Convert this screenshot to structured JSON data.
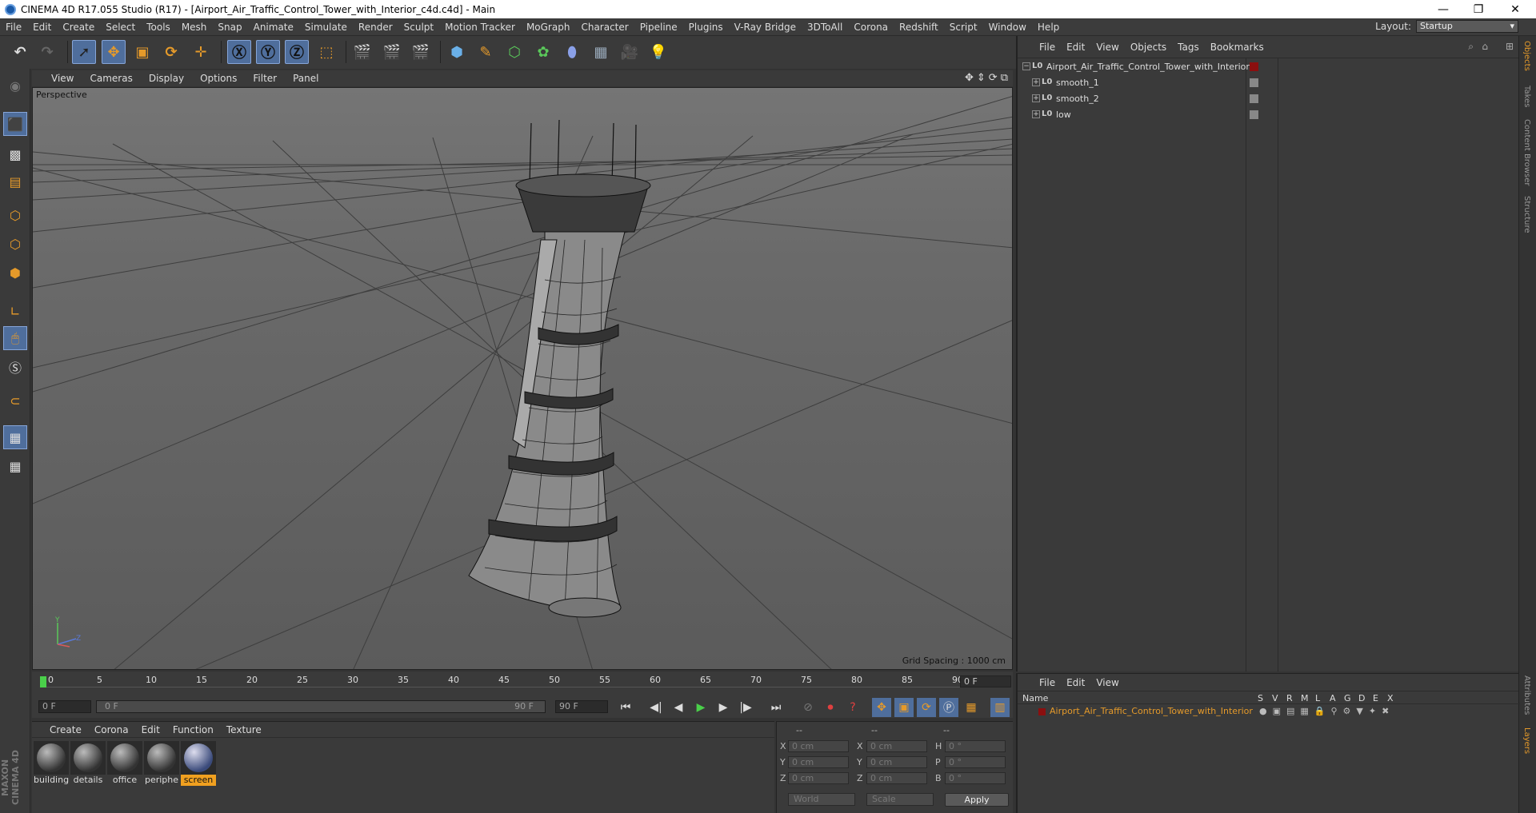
{
  "window": {
    "title": "CINEMA 4D R17.055 Studio (R17) - [Airport_Air_Traffic_Control_Tower_with_Interior_c4d.c4d] - Main"
  },
  "menubar": {
    "items": [
      "File",
      "Edit",
      "Create",
      "Select",
      "Tools",
      "Mesh",
      "Snap",
      "Animate",
      "Simulate",
      "Render",
      "Sculpt",
      "Motion Tracker",
      "MoGraph",
      "Character",
      "Pipeline",
      "Plugins",
      "V-Ray Bridge",
      "3DToAll",
      "Corona",
      "Redshift",
      "Script",
      "Window",
      "Help"
    ],
    "layout_label": "Layout:",
    "layout_value": "Startup"
  },
  "viewport": {
    "menu": [
      "View",
      "Cameras",
      "Display",
      "Options",
      "Filter",
      "Panel"
    ],
    "camera_label": "Perspective",
    "grid_spacing": "Grid Spacing : 1000 cm"
  },
  "timeline": {
    "ticks": [
      "0",
      "5",
      "10",
      "15",
      "20",
      "25",
      "30",
      "35",
      "40",
      "45",
      "50",
      "55",
      "60",
      "65",
      "70",
      "75",
      "80",
      "85",
      "90"
    ],
    "current_frame": "0 F",
    "start_field": "0 F",
    "range_start": "0 F",
    "range_end": "90 F",
    "end_field": "90 F"
  },
  "materials": {
    "menu": [
      "Create",
      "Corona",
      "Edit",
      "Function",
      "Texture"
    ],
    "items": [
      "building",
      "details",
      "office",
      "periphe",
      "screen"
    ],
    "selected": "screen"
  },
  "coordinates": {
    "header": [
      "--",
      "--",
      "--"
    ],
    "rows": [
      {
        "a": "X",
        "av": "0 cm",
        "b": "X",
        "bv": "0 cm",
        "c": "H",
        "cv": "0 °"
      },
      {
        "a": "Y",
        "av": "0 cm",
        "b": "Y",
        "bv": "0 cm",
        "c": "P",
        "cv": "0 °"
      },
      {
        "a": "Z",
        "av": "0 cm",
        "b": "Z",
        "bv": "0 cm",
        "c": "B",
        "cv": "0 °"
      }
    ],
    "mode1": "World",
    "mode2": "Scale",
    "apply": "Apply"
  },
  "objects": {
    "menu": [
      "File",
      "Edit",
      "View",
      "Objects",
      "Tags",
      "Bookmarks"
    ],
    "tree": [
      "Airport_Air_Traffic_Control_Tower_with_Interior",
      "smooth_1",
      "smooth_2",
      "low"
    ]
  },
  "right_tabs": [
    "Objects",
    "Takes",
    "Content Browser",
    "Structure"
  ],
  "right_tabs_lower": [
    "Attributes",
    "Layers"
  ],
  "layers": {
    "menu": [
      "File",
      "Edit",
      "View"
    ],
    "name_header": "Name",
    "flags": [
      "S",
      "V",
      "R",
      "M",
      "L",
      "A",
      "G",
      "D",
      "E",
      "X"
    ],
    "row": "Airport_Air_Traffic_Control_Tower_with_Interior",
    "color": "#8b0f0f"
  },
  "colors": {
    "accent": "#e59a2a",
    "active_tool": "#4f6e9c",
    "object_color": "#8b0f0f"
  },
  "branding": "MAXON CINEMA 4D"
}
